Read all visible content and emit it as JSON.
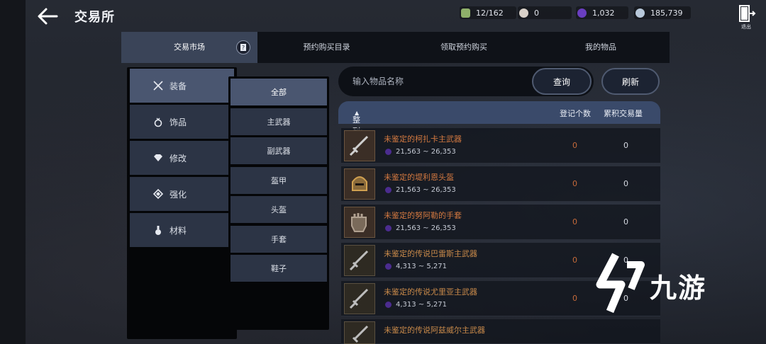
{
  "header": {
    "title": "交易所",
    "exit_label": "退出"
  },
  "currencies": [
    {
      "icon": "inventory-icon",
      "value": "12/162",
      "color": "#8fb06a"
    },
    {
      "icon": "pearl-icon",
      "value": "0",
      "color": "#d8d0c8"
    },
    {
      "icon": "crystal-icon",
      "value": "1,032",
      "color": "#6a3ec0"
    },
    {
      "icon": "silver-coin-icon",
      "value": "185,739",
      "color": "#b8c8da"
    }
  ],
  "tabs": [
    {
      "label": "交易市场",
      "active": true
    },
    {
      "label": "预约购买目录",
      "active": false
    },
    {
      "label": "领取预约购买",
      "active": false
    },
    {
      "label": "我的物品",
      "active": false
    }
  ],
  "categories": [
    {
      "label": "装备",
      "icon": "crossed-swords-icon",
      "active": true
    },
    {
      "label": "饰品",
      "icon": "ring-icon",
      "active": false
    },
    {
      "label": "修改",
      "icon": "gem-icon",
      "active": false
    },
    {
      "label": "强化",
      "icon": "rune-icon",
      "active": false
    },
    {
      "label": "材料",
      "icon": "flask-icon",
      "active": false
    }
  ],
  "subcategories": [
    {
      "label": "全部",
      "active": true
    },
    {
      "label": "主武器",
      "active": false
    },
    {
      "label": "副武器",
      "active": false
    },
    {
      "label": "盔甲",
      "active": false
    },
    {
      "label": "头盔",
      "active": false
    },
    {
      "label": "手套",
      "active": false
    },
    {
      "label": "鞋子",
      "active": false
    }
  ],
  "search": {
    "placeholder": "输入物品名称",
    "query_label": "查询",
    "refresh_label": "刷新"
  },
  "list": {
    "sort_label": "整列: 等级",
    "col_registered": "登记个数",
    "col_volume": "累积交易量",
    "rows": [
      {
        "name": "未鉴定的柯扎卡主武器",
        "price": "21,563 ~ 26,353",
        "count": "0",
        "volume": "0",
        "icon": "sword-icon"
      },
      {
        "name": "未鉴定的堤利恩头盔",
        "price": "21,563 ~ 26,353",
        "count": "0",
        "volume": "0",
        "icon": "helmet-icon"
      },
      {
        "name": "未鉴定的努阿勒的手套",
        "price": "21,563 ~ 26,353",
        "count": "0",
        "volume": "0",
        "icon": "gauntlet-icon"
      },
      {
        "name": "未鉴定的传说巴雷斯主武器",
        "price": "4,313 ~ 5,271",
        "count": "0",
        "volume": "0",
        "icon": "sword-icon"
      },
      {
        "name": "未鉴定的传说尤里亚主武器",
        "price": "4,313 ~ 5,271",
        "count": "0",
        "volume": "0",
        "icon": "sword-icon"
      },
      {
        "name": "未鉴定的传说阿兹威尔主武器",
        "price": "",
        "count": "",
        "volume": "",
        "icon": "sword-icon"
      }
    ]
  },
  "watermark": {
    "text": "九游"
  }
}
